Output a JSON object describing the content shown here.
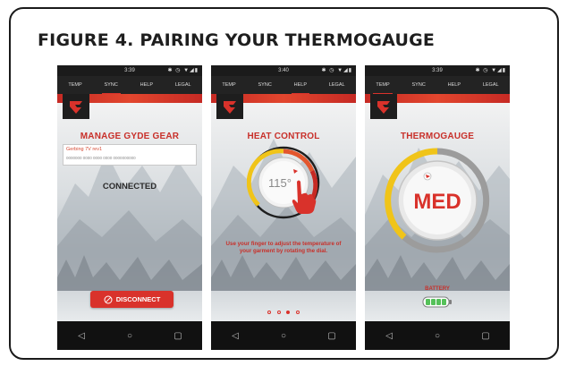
{
  "figure": {
    "title": "FIGURE 4. PAIRING YOUR THERMOGAUGE"
  },
  "colors": {
    "accent": "#d9322b",
    "dark": "#1e1e1e",
    "yellow": "#f0c419",
    "battery": "#55c159"
  },
  "phones": [
    {
      "time": "3:39",
      "tabs": [
        "TEMP",
        "SYNC",
        "HELP",
        "LEGAL"
      ],
      "active_tab": "SYNC",
      "title": "MANAGE GYDE GEAR",
      "device_name": "Gerbing 7V rev1",
      "device_id": "0000000 0000 0000 0000 0000000000",
      "status": "CONNECTED",
      "button": "DISCONNECT"
    },
    {
      "time": "3:40",
      "tabs": [
        "TEMP",
        "SYNC",
        "HELP",
        "LEGAL"
      ],
      "active_tab": "HELP",
      "title": "HEAT CONTROL",
      "dial_value": "115°",
      "help_text": "Use your finger to adjust the temperature of your garment by rotating the dial."
    },
    {
      "time": "3:39",
      "tabs": [
        "TEMP",
        "SYNC",
        "HELP",
        "LEGAL"
      ],
      "active_tab": "TEMP",
      "title": "THERMOGAUGE",
      "level": "MED",
      "battery_label": "BATTERY"
    }
  ],
  "nav": {
    "back": "◁",
    "home": "○",
    "recent": "▢"
  },
  "status_icons": "✱ ◷ ▼◢▮"
}
